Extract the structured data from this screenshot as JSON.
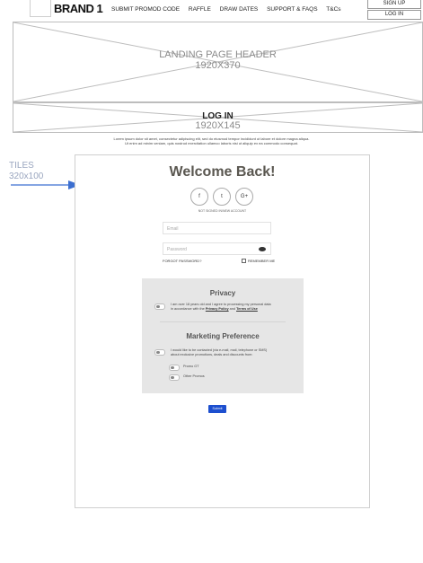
{
  "nav": {
    "brand": "BRAND 1",
    "links": [
      "SUBMIT PROMOD CODE",
      "RAFFLE",
      "DRAW DATES",
      "SUPPORT & FAQS",
      "T&Cs"
    ],
    "signup": "SIGN UP",
    "login": "LOG IN"
  },
  "header_placeholder": {
    "title": "LANDING PAGE HEADER",
    "size": "1920X370"
  },
  "login_placeholder": {
    "title": "LOG IN",
    "size": "1920X145"
  },
  "lorem": {
    "line1": "Lorem ipsum dolor sit amet, consectetur adipiscing elit, sed do eiusmod tempor incididunt ut labore et dolore magna aliqua.",
    "line2": "Ut enim ad minim veniam, quis nostrud exercitation ullamco laboris nisi ut aliquip ex ea commodo consequat."
  },
  "annotation": {
    "title": "TILES",
    "size": "320x100"
  },
  "form": {
    "title": "Welcome Back!",
    "socials": [
      "f",
      "t",
      "G+"
    ],
    "social_hint": "NOT SIGNED IN/NEW ACCOUNT",
    "email_placeholder": "Email",
    "password_placeholder": "Password",
    "forgot": "FORGOT PASSWORD?",
    "remember": "REMEMBER ME",
    "privacy": {
      "title": "Privacy",
      "text_a": "I am over 18 years old and I agree to processing my personal data",
      "text_b": "in accordance with the ",
      "link1": "Privacy Policy",
      "and": " and ",
      "link2": "Terms of Use"
    },
    "marketing": {
      "title": "Marketing Preference",
      "text_a": "I would like to be contacted (via e-mail, mail, telephone or SMS)",
      "text_b": "about exclusive promotions, deals and discounts from:",
      "opt1": "Promo GT",
      "opt2": "Other Promos"
    },
    "submit": "Submit"
  }
}
